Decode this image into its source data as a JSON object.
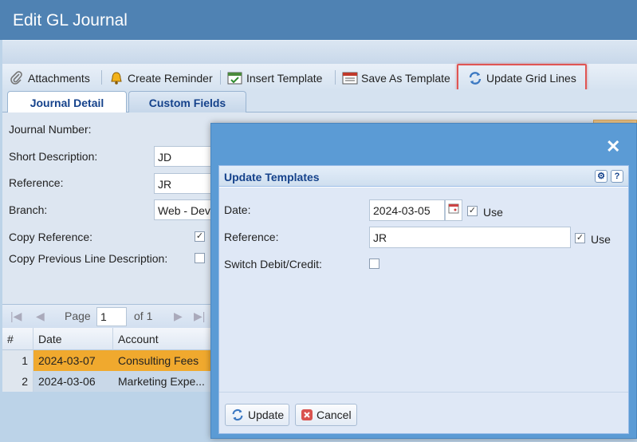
{
  "window": {
    "title": "Edit GL Journal"
  },
  "toolbar": {
    "attachments": "Attachments",
    "create_reminder": "Create Reminder",
    "insert_template": "Insert Template",
    "save_as_template": "Save As Template",
    "update_grid_lines": "Update Grid Lines"
  },
  "tabs": [
    {
      "label": "Journal Detail",
      "active": true
    },
    {
      "label": "Custom Fields",
      "active": false
    }
  ],
  "form": {
    "journal_number_label": "Journal Number:",
    "short_description_label": "Short Description:",
    "short_description_value": "JD",
    "reference_label": "Reference:",
    "reference_value": "JR",
    "branch_label": "Branch:",
    "branch_value": "Web - Dev",
    "copy_reference_label": "Copy Reference:",
    "copy_reference_checked": true,
    "copy_prev_desc_label": "Copy Previous Line Description:",
    "copy_prev_desc_checked": false
  },
  "pager": {
    "page_label": "Page",
    "page_value": "1",
    "of_label": "of 1"
  },
  "grid": {
    "columns": [
      "#",
      "Date",
      "Account"
    ],
    "rows": [
      {
        "num": "1",
        "date": "2024-03-07",
        "account": "Consulting Fees"
      },
      {
        "num": "2",
        "date": "2024-03-06",
        "account": "Marketing Expe..."
      }
    ]
  },
  "dialog": {
    "close_icon": "close-icon",
    "panel_title": "Update Templates",
    "date_label": "Date:",
    "date_value": "2024-03-05",
    "date_use_label": "Use",
    "date_use_checked": true,
    "reference_label": "Reference:",
    "reference_value": "JR",
    "reference_use_label": "Use",
    "reference_use_checked": true,
    "switch_label": "Switch Debit/Credit:",
    "switch_checked": false,
    "update_button": "Update",
    "cancel_button": "Cancel"
  },
  "colors": {
    "accent": "#4f82b3",
    "highlight": "#e05553",
    "selected_row": "#f0a92e"
  }
}
